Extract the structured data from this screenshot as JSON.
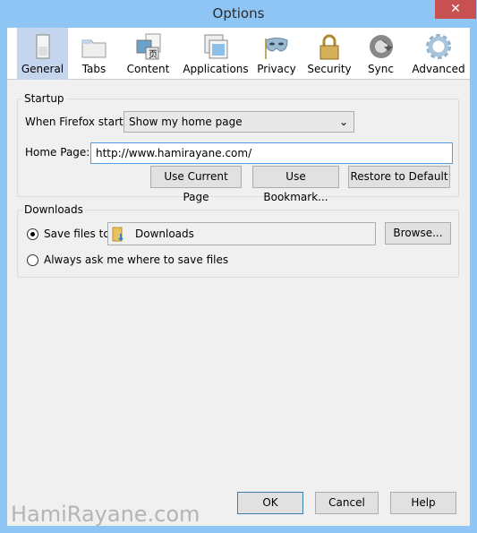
{
  "window": {
    "title": "Options",
    "close_icon": "close-icon"
  },
  "toolbar": {
    "tabs": [
      {
        "label": "General",
        "icon": "light-switch-icon",
        "selected": true
      },
      {
        "label": "Tabs",
        "icon": "tabs-folder-icon"
      },
      {
        "label": "Content",
        "icon": "content-pictures-icon"
      },
      {
        "label": "Applications",
        "icon": "applications-window-icon"
      },
      {
        "label": "Privacy",
        "icon": "mask-icon"
      },
      {
        "label": "Security",
        "icon": "padlock-icon"
      },
      {
        "label": "Sync",
        "icon": "sync-arrows-icon"
      },
      {
        "label": "Advanced",
        "icon": "gear-icon"
      }
    ]
  },
  "startup": {
    "legend": "Startup",
    "when_label": "When Firefox starts:",
    "when_value": "Show my home page",
    "home_label": "Home Page:",
    "home_value": "http://www.hamirayane.com/",
    "use_current": "Use Current Page",
    "use_bookmark": "Use Bookmark...",
    "restore_default": "Restore to Default"
  },
  "downloads": {
    "legend": "Downloads",
    "save_label": "Save files to",
    "folder": "Downloads",
    "browse": "Browse...",
    "ask_label": "Always ask me where to save files",
    "save_selected": true
  },
  "footer": {
    "ok": "OK",
    "cancel": "Cancel",
    "help": "Help"
  },
  "watermark": "HamiRayane.com"
}
